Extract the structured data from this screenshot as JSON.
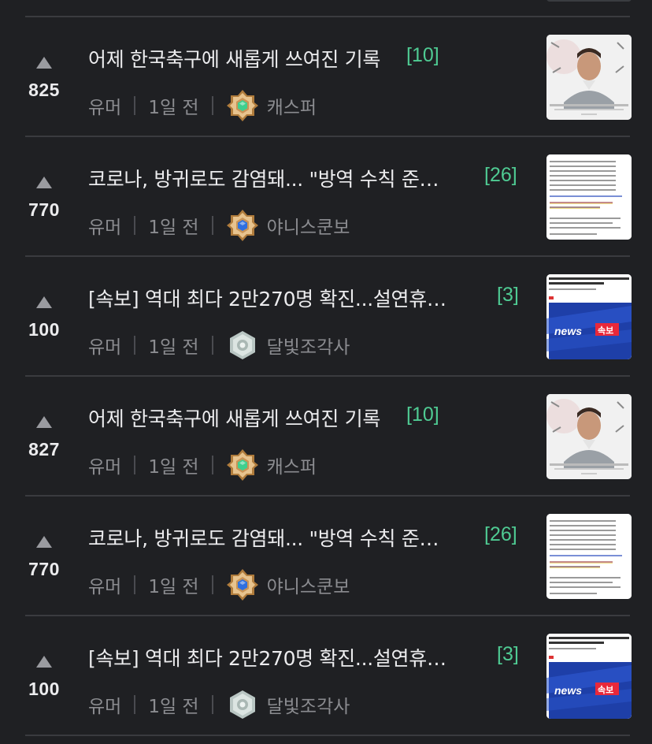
{
  "posts": [
    {
      "votes": "825",
      "title": "어제 한국축구에 새롭게 쓰여진 기록",
      "comments": "[10]",
      "category": "유머",
      "time": "1일 전",
      "author": "캐스퍼",
      "badge": "hex-green",
      "thumb": "portrait"
    },
    {
      "votes": "770",
      "title": "코로나, 방귀로도 감염돼... \"방역 수칙 준…",
      "comments": "[26]",
      "category": "유머",
      "time": "1일 전",
      "author": "야니스쿤보",
      "badge": "hex-blue",
      "thumb": "article"
    },
    {
      "votes": "100",
      "title": "[속보] 역대 최다 2만270명 확진...설연휴…",
      "comments": "[3]",
      "category": "유머",
      "time": "1일 전",
      "author": "달빛조각사",
      "badge": "circle-silver",
      "thumb": "news"
    },
    {
      "votes": "827",
      "title": "어제 한국축구에 새롭게 쓰여진 기록",
      "comments": "[10]",
      "category": "유머",
      "time": "1일 전",
      "author": "캐스퍼",
      "badge": "hex-green",
      "thumb": "portrait"
    },
    {
      "votes": "770",
      "title": "코로나, 방귀로도 감염돼... \"방역 수칙 준…",
      "comments": "[26]",
      "category": "유머",
      "time": "1일 전",
      "author": "야니스쿤보",
      "badge": "hex-blue",
      "thumb": "article"
    },
    {
      "votes": "100",
      "title": "[속보] 역대 최다 2만270명 확진...설연휴…",
      "comments": "[3]",
      "category": "유머",
      "time": "1일 전",
      "author": "달빛조각사",
      "badge": "circle-silver",
      "thumb": "news"
    }
  ],
  "thumb_text": {
    "news_logo": "news",
    "news_tag": "속보"
  },
  "colors": {
    "background": "#1f2023",
    "accent": "#4fcb93",
    "muted": "#8b8c90",
    "divider": "#3a3b3f"
  }
}
